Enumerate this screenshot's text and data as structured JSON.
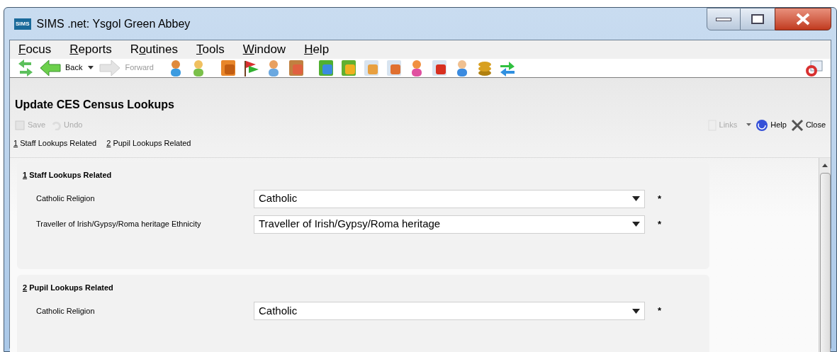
{
  "window": {
    "logo": "SIMS",
    "title": "SIMS .net: Ysgol Green Abbey"
  },
  "menu": [
    {
      "key": "F",
      "post": "ocus"
    },
    {
      "key": "R",
      "post": "eports"
    },
    {
      "pre": "R",
      "key": "o",
      "post": "utines"
    },
    {
      "key": "T",
      "post": "ools"
    },
    {
      "key": "W",
      "post": "indow"
    },
    {
      "key": "H",
      "post": "elp"
    }
  ],
  "toolbar": {
    "back": {
      "label": "Back",
      "disabled": false
    },
    "forward": {
      "label": "Forward",
      "disabled": true
    }
  },
  "page": {
    "title": "Update CES Census Lookups",
    "actions": [
      {
        "kind": "save",
        "label": "Save",
        "disabled": true
      },
      {
        "kind": "undo",
        "label": "Undo",
        "disabled": true
      }
    ],
    "right_actions": [
      {
        "kind": "links",
        "label": "Links",
        "disabled": true
      },
      {
        "kind": "help",
        "label": "Help",
        "disabled": false
      },
      {
        "kind": "close",
        "label": "Close",
        "disabled": false
      }
    ],
    "nav": [
      {
        "key": "1",
        "post": " Staff Lookups Related"
      },
      {
        "key": "2",
        "post": " Pupil Lookups Related"
      }
    ]
  },
  "sections": [
    {
      "key": "1",
      "post": " Staff Lookups Related",
      "fields": [
        {
          "label": "Catholic Religion",
          "value": "Catholic",
          "required_mark": "*"
        },
        {
          "label": "Traveller of Irish/Gypsy/Roma heritage Ethnicity",
          "value": "Traveller of Irish/Gypsy/Roma heritage",
          "required_mark": "*"
        }
      ]
    },
    {
      "key": "2",
      "post": " Pupil Lookups Related",
      "fields": [
        {
          "label": "Catholic Religion",
          "value": "Catholic",
          "required_mark": "*"
        }
      ]
    }
  ]
}
